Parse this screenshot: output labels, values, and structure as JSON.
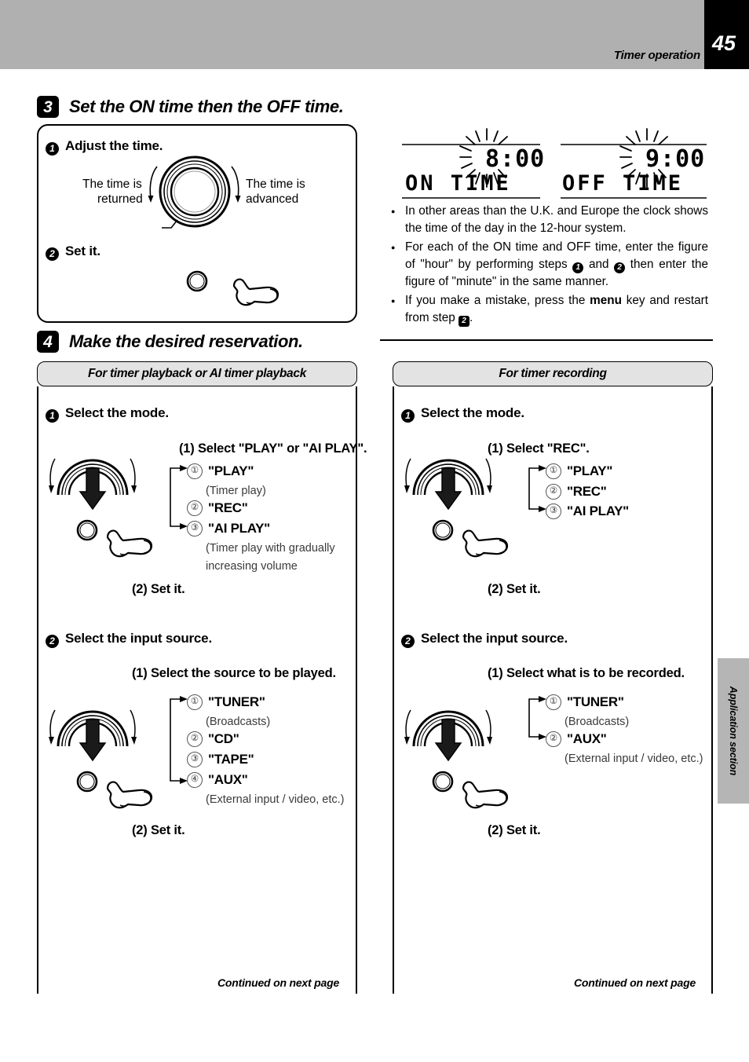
{
  "header": {
    "title": "Timer operation",
    "page_number": "45"
  },
  "side_tab": {
    "label": "Application section"
  },
  "step3": {
    "number": "3",
    "title": "Set the ON time then the OFF time.",
    "sub1": {
      "badge": "1",
      "label": "Adjust the time."
    },
    "dial_left_line1": "The time is",
    "dial_left_line2": "returned",
    "dial_right_line1": "The time is",
    "dial_right_line2": "advanced",
    "sub2": {
      "badge": "2",
      "label": "Set it."
    }
  },
  "displays": {
    "on": {
      "label": "ON TIME",
      "time": "8:00"
    },
    "off": {
      "label": "OFF TIME",
      "time": "9:00"
    }
  },
  "notes": [
    {
      "parts": [
        {
          "text": "In other areas than the U.K. and Europe the clock shows the time of the day in the 12-hour system."
        }
      ]
    },
    {
      "parts": [
        {
          "text": "For each of the ON time and OFF time, enter the figure of \"hour\" by performing steps "
        },
        {
          "badge_circle": "1"
        },
        {
          "text": " and "
        },
        {
          "badge_circle": "2"
        },
        {
          "text": " then enter the figure of \"minute\" in the same manner."
        }
      ]
    },
    {
      "parts": [
        {
          "text": "If you make a mistake, press the "
        },
        {
          "strong": "menu"
        },
        {
          "text": " key and restart from step "
        },
        {
          "badge_square": "2"
        },
        {
          "text": "."
        }
      ]
    }
  ],
  "step4": {
    "number": "4",
    "title": "Make the desired reservation."
  },
  "left_column": {
    "section_header": "For timer playback or AI timer playback",
    "step1": {
      "badge": "1",
      "label": "Select the mode.",
      "instruction": "(1) Select \"PLAY\" or \"AI PLAY\".",
      "options": [
        {
          "num": "①",
          "label": "\"PLAY\"",
          "note": "(Timer play)"
        },
        {
          "num": "②",
          "label": "\"REC\"",
          "note": ""
        },
        {
          "num": "③",
          "label": "\"AI  PLAY\"",
          "note": "(Timer play with gradually"
        },
        {
          "note2": "increasing volume"
        }
      ],
      "set_it": "(2) Set it."
    },
    "step2": {
      "badge": "2",
      "label": "Select the input source.",
      "instruction": "(1)  Select the source to be played.",
      "options": [
        {
          "num": "①",
          "label": "\"TUNER\"",
          "note": "(Broadcasts)"
        },
        {
          "num": "②",
          "label": "\"CD\"",
          "note": ""
        },
        {
          "num": "③",
          "label": "\"TAPE\"",
          "note": ""
        },
        {
          "num": "④",
          "label": "\"AUX\"",
          "note": "(External input / video, etc.)"
        }
      ],
      "set_it": "(2) Set it."
    },
    "continued": "Continued on next page"
  },
  "right_column": {
    "section_header": "For timer recording",
    "step1": {
      "badge": "1",
      "label": "Select the mode.",
      "instruction": "(1) Select \"REC\".",
      "options": [
        {
          "num": "①",
          "label": "\"PLAY\""
        },
        {
          "num": "②",
          "label": "\"REC\""
        },
        {
          "num": "③",
          "label": "\"AI  PLAY\""
        }
      ],
      "set_it": "(2) Set it."
    },
    "step2": {
      "badge": "2",
      "label": "Select the input source.",
      "instruction": "(1) Select what is to be recorded.",
      "options": [
        {
          "num": "①",
          "label": "\"TUNER\"",
          "note": "(Broadcasts)"
        },
        {
          "num": "②",
          "label": "\"AUX\"",
          "note": "(External input / video, etc.)"
        }
      ],
      "set_it": "(2) Set it."
    },
    "continued": "Continued on next page"
  }
}
